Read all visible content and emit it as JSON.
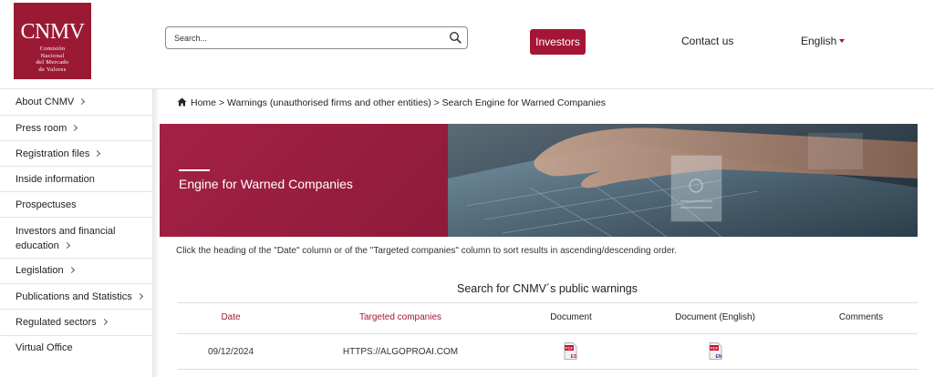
{
  "header": {
    "logo": {
      "text": "CNMV",
      "subtitle_lines": [
        "Comisión",
        "Nacional",
        "del Mercado",
        "de Valores"
      ]
    },
    "search": {
      "placeholder": "Search..."
    },
    "investors_label": "Investors",
    "contact_label": "Contact us",
    "language_label": "English",
    "accent_color": "#a51636"
  },
  "sidebar": {
    "items": [
      {
        "label": "About CNMV",
        "has_chevron": true
      },
      {
        "label": "Press room",
        "has_chevron": true
      },
      {
        "label": "Registration files",
        "has_chevron": true
      },
      {
        "label": "Inside information",
        "has_chevron": false
      },
      {
        "label": "Prospectuses",
        "has_chevron": false
      },
      {
        "label_line1": "Investors and financial",
        "label_line2": "education",
        "has_chevron": true
      },
      {
        "label": "Legislation",
        "has_chevron": true
      },
      {
        "label": "Publications and Statistics",
        "has_chevron": true
      },
      {
        "label": "Regulated sectors",
        "has_chevron": true
      },
      {
        "label": "Virtual Office",
        "has_chevron": false
      }
    ]
  },
  "breadcrumb": {
    "text": "Home > Warnings (unauthorised firms and other entities) > Search Engine for Warned Companies"
  },
  "banner": {
    "title": "Engine for Warned Companies"
  },
  "instructions": "Click the heading of the \"Date\" column or of the \"Targeted companies\" column to sort results in ascending/descending order.",
  "table": {
    "title": "Search for CNMV´s public warnings",
    "headers": {
      "date": "Date",
      "company": "Targeted companies",
      "document": "Document",
      "document_en": "Document (English)",
      "comments": "Comments"
    },
    "rows": [
      {
        "date": "09/12/2024",
        "company": "HTTPS://ALGOPROAI.COM",
        "document_icon": "pdf-es-icon",
        "document_en_icon": "pdf-en-icon",
        "comments": ""
      }
    ]
  }
}
